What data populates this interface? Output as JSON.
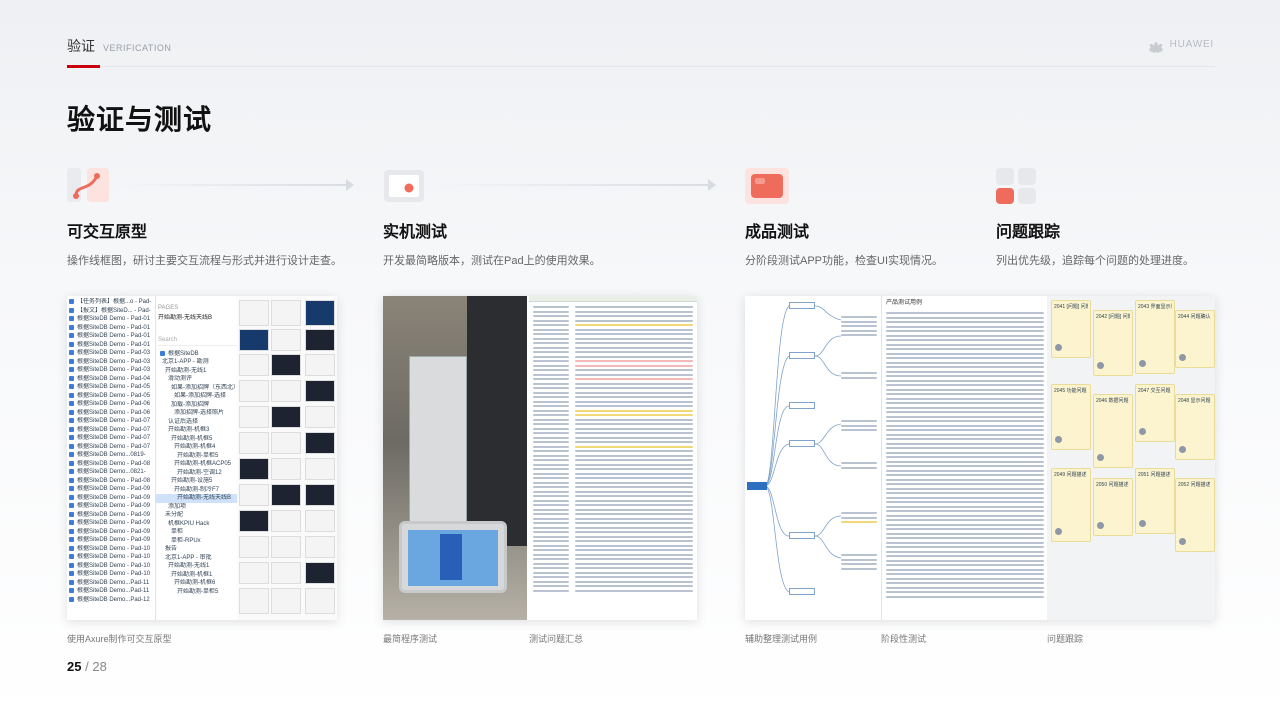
{
  "header": {
    "section": "验证",
    "section_en": "VERIFICATION",
    "brand": "HUAWEI"
  },
  "page_title": "验证与测试",
  "steps": [
    {
      "name": "可交互原型",
      "desc": "操作线框图，研讨主要交互流程与形式并进行设计走查。",
      "icon": "phone-prototype-icon"
    },
    {
      "name": "实机测试",
      "desc": "开发最简略版本，测试在Pad上的使用效果。",
      "icon": "tablet-device-icon"
    },
    {
      "name": "成品测试",
      "desc": "分阶段测试APP功能，检查UI实现情况。",
      "icon": "finished-product-icon"
    },
    {
      "name": "问题跟踪",
      "desc": "列出优先级，追踪每个问题的处理进度。",
      "icon": "grid-tracking-icon"
    }
  ],
  "screenshots": {
    "axure": {
      "tree_items": [
        "【任务列表】根据...o - Pad-",
        "【报文】根据SiteD... - Pad-",
        "根据SiteDB Demo - Pad-01",
        "根据SiteDB Demo - Pad-01",
        "根据SiteDB Demo - Pad-01",
        "根据SiteDB Demo - Pad-01",
        "根据SiteDB Demo - Pad-03",
        "根据SiteDB Demo - Pad-03",
        "根据SiteDB Demo - Pad-03",
        "根据SiteDB Demo - Pad-04",
        "根据SiteDB Demo - Pad-05",
        "根据SiteDB Demo - Pad-05",
        "根据SiteDB Demo - Pad-06",
        "根据SiteDB Demo - Pad-06",
        "根据SiteDB Demo - Pad-07",
        "根据SiteDB Demo - Pad-07",
        "根据SiteDB Demo - Pad-07",
        "根据SiteDB Demo - Pad-07",
        "根据SiteDB Demo...0819-",
        "根据SiteDB Demo - Pad-08",
        "根据SiteDB Demo...0821-",
        "根据SiteDB Demo - Pad-08",
        "根据SiteDB Demo - Pad-09",
        "根据SiteDB Demo - Pad-09",
        "根据SiteDB Demo - Pad-09",
        "根据SiteDB Demo - Pad-09",
        "根据SiteDB Demo - Pad-09",
        "根据SiteDB Demo - Pad-09",
        "根据SiteDB Demo - Pad-09",
        "根据SiteDB Demo - Pad-10",
        "根据SiteDB Demo - Pad-10",
        "根据SiteDB Demo - Pad-10",
        "根据SiteDB Demo - Pad-10",
        "根据SiteDB Demo...Pad-11",
        "根据SiteDB Demo...Pad-11",
        "根据SiteDB Demo...Pad-12"
      ],
      "pages_label": "PAGES",
      "pages_title": "开始勘测-无线天线B",
      "search_placeholder": "Search",
      "site": "根据SiteDB",
      "nodes": [
        "北京1-APP - 勘测",
        "开始勘测-无线1",
        "滑动测评",
        "如果-添加招牌（东西北）",
        "如果-添加招牌-选择",
        "加载-添加招牌",
        "添加招牌-选择照片",
        "认证后选择",
        "开始勘测-机框3",
        "开始勘测-机框5",
        "开始勘测-机框4",
        "开始勘测-单柜5",
        "开始勘测-机框ACP05",
        "开始勘测-空调12",
        "开始勘测-设施5",
        "开始勘测-制冷F7",
        "开始勘测-无线天线B",
        "添加项",
        "未分配",
        "机框KPIU Hack",
        "单柜",
        "单柜-RPUx",
        "报告",
        "北京1-APP - 审批",
        "开始勘测-无线1",
        "开始勘测-机框1",
        "开始勘测-机框6",
        "开始勘测-单柜5"
      ]
    },
    "mindmap_label": "产品测试用例",
    "board": {
      "cards": [
        "2041 [问题] 问题描述",
        "2042 [问题] 问题描述",
        "2043 界面显示问题",
        "2044 问题确认",
        "2045 功能问题",
        "2046 数据问题",
        "2047 交互问题",
        "2048 显示问题",
        "2049 问题描述",
        "2050 问题描述",
        "2051 问题描述",
        "2052 问题描述"
      ]
    }
  },
  "captions": [
    "使用Axure制作可交互原型",
    "最简程序测试",
    "测试问题汇总",
    "辅助整理测试用例",
    "阶段性测试",
    "问题跟踪"
  ],
  "page_number": {
    "current": "25",
    "separator": "/",
    "total": "28"
  },
  "colors": {
    "accent_red": "#c7000b",
    "icon_coral": "#ef6b5b",
    "title_black": "#111111"
  }
}
